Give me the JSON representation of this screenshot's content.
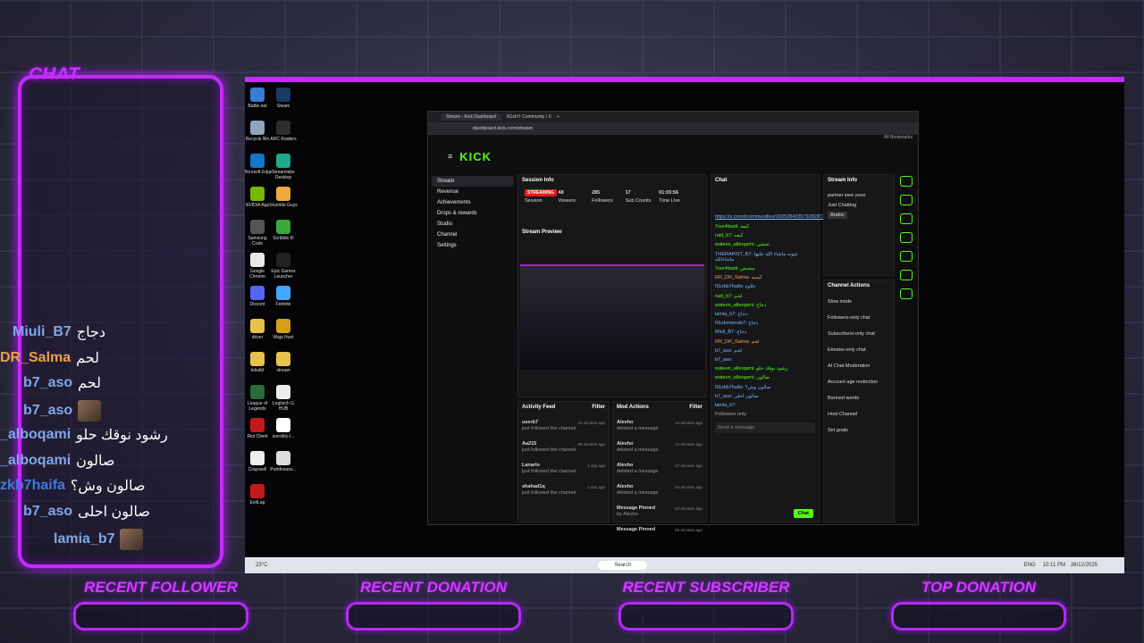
{
  "overlay": {
    "chat_title": "CHAT",
    "labels": [
      "RECENT FOLLOWER",
      "RECENT DONATION",
      "RECENT SUBSCRIBER",
      "TOP DONATION"
    ]
  },
  "chat": [
    {
      "user": "Miuli_B7",
      "text": "دجاج",
      "color": "#7fa8e8"
    },
    {
      "user": "DR_Salma",
      "text": "لحم",
      "color": "#f0a04a"
    },
    {
      "user": "b7_aso",
      "text": "لحم",
      "color": "#7fa8e8"
    },
    {
      "user": "b7_aso",
      "text": "",
      "color": "#7fa8e8",
      "avatar": true
    },
    {
      "user": "_alboqami",
      "text": "رشود نوقك حلو",
      "color": "#7fa8e8"
    },
    {
      "user": "_alboqami",
      "text": "صالون",
      "color": "#7fa8e8"
    },
    {
      "user": "zkb7haifa",
      "text": "صالون وش؟",
      "color": "#3f7ad8"
    },
    {
      "user": "b7_aso",
      "text": "صالون احلى",
      "color": "#7fa8e8"
    },
    {
      "user": "lamia_b7",
      "text": "",
      "color": "#7fa8e8",
      "avatar": true
    }
  ],
  "browser": {
    "tab1": "Stream - Kick Dashboard",
    "tab2": "N1zk7r Community / X",
    "url": "dashboard.kick.com/stream",
    "bookmarks": "All Bookmarks",
    "logo": "KICK",
    "nav": [
      "Stream",
      "Revenue",
      "Achievements",
      "Drops & rewards",
      "Studio",
      "Channel",
      "Settings"
    ],
    "session": {
      "title": "Session Info",
      "badge": "STREAMING",
      "labels": [
        "Session",
        "Viewers",
        "Followers",
        "Sub Counts",
        "Time Live"
      ],
      "values": [
        "",
        "48",
        "285",
        "17",
        "01:03:56"
      ]
    },
    "preview_title": "Stream Preview",
    "activity": {
      "title": "Activity Feed",
      "filter": "Filter",
      "items": [
        {
          "u": "userb7",
          "t": "11 minutes ago",
          "d": "just followed the channel"
        },
        {
          "u": "Aa215",
          "t": "48 minutes ago",
          "d": "just followed the channel"
        },
        {
          "u": "Lanarlo",
          "t": "1 day ago",
          "d": "just followed the channel"
        },
        {
          "u": "shahad1q",
          "t": "1 day ago",
          "d": "just followed the channel"
        }
      ]
    },
    "modactions": {
      "title": "Mod Actions",
      "filter": "Filter",
      "items": [
        {
          "u": "Alesho",
          "t": "14 minutes ago",
          "d": "deleted a message"
        },
        {
          "u": "Alesho",
          "t": "14 minutes ago",
          "d": "deleted a message"
        },
        {
          "u": "Alesho",
          "t": "17 minutes ago",
          "d": "deleted a message"
        },
        {
          "u": "Alesho",
          "t": "14 minutes ago",
          "d": "deleted a message"
        },
        {
          "u": "Message Pinned",
          "t": "54 minutes ago",
          "d": "by Alesho"
        },
        {
          "u": "Message Pinned",
          "t": "55 minutes ago",
          "d": ""
        }
      ]
    },
    "chat": {
      "title": "Chat",
      "pinned_link": "https://x.com/i/communities/2005284335792828720",
      "send": "Send a message",
      "btn": "Chat",
      "followers_only": "Followers only",
      "lines": [
        "7oorAbadi: كيفه",
        "raid_b7: كيفه",
        "wateen_alboqami: تحشى",
        "THERAPIST_B7: عيونه ماشاء الله عليها ماشاءالله",
        "7oorAbadi: مشبص",
        "RR_DR_Salma: كبسه",
        "N1zkb7haifa: حلاوة",
        "raid_b7: لحم",
        "wateen_alboqami: دجاج",
        "lamia_b7: دجاج",
        "N1zkmeerab7: دجاج",
        "Miuli_B7: دجاج",
        "RR_DR_Salma: لحم",
        "b7_aso: لحم",
        "b7_aso:",
        "wateen_alboqami: رشود نوقك حلو",
        "wateen_alboqami: صالون",
        "N1zkb7haifa: صالون وش؟",
        "b7_aso: صالون احلى",
        "lamia_b7:"
      ]
    },
    "streaminfo": {
      "title": "Stream Info",
      "stream_title": "partner wee yooo",
      "category": "Just Chatting",
      "tag": "Arabic"
    },
    "actions": {
      "title": "Channel Actions",
      "items": [
        "Slow mode",
        "Followers-only chat",
        "Subscribers-only chat",
        "Emotes-only chat",
        "AI Chat Moderation",
        "Account age restriction",
        "Banned words",
        "Host Channel",
        "Set goals"
      ]
    }
  },
  "desktop": [
    "Battle.net",
    "Steam",
    "Recycle Bin",
    "ARC Raiders",
    "Microsoft Edge",
    "Streamlabs Desktop",
    "NVIDIA App",
    "Stumble Guys",
    "Samsung Crate",
    "Scribble It!",
    "Google Chrome",
    "Epic Games Launcher",
    "Discord",
    "Fortnite",
    "driver",
    "Waja Hunt",
    "hdsdbf",
    "stream",
    "League of Legends",
    "Logitech G HUB",
    "Riot Client",
    "soccility-l...",
    "Crayssell",
    "Pumfesaso...",
    "ExitLag"
  ],
  "taskbar": {
    "weather": "23°C",
    "search": "Search",
    "time": "10:11 PM",
    "date": "26/12/2025",
    "lang": "ENG"
  }
}
